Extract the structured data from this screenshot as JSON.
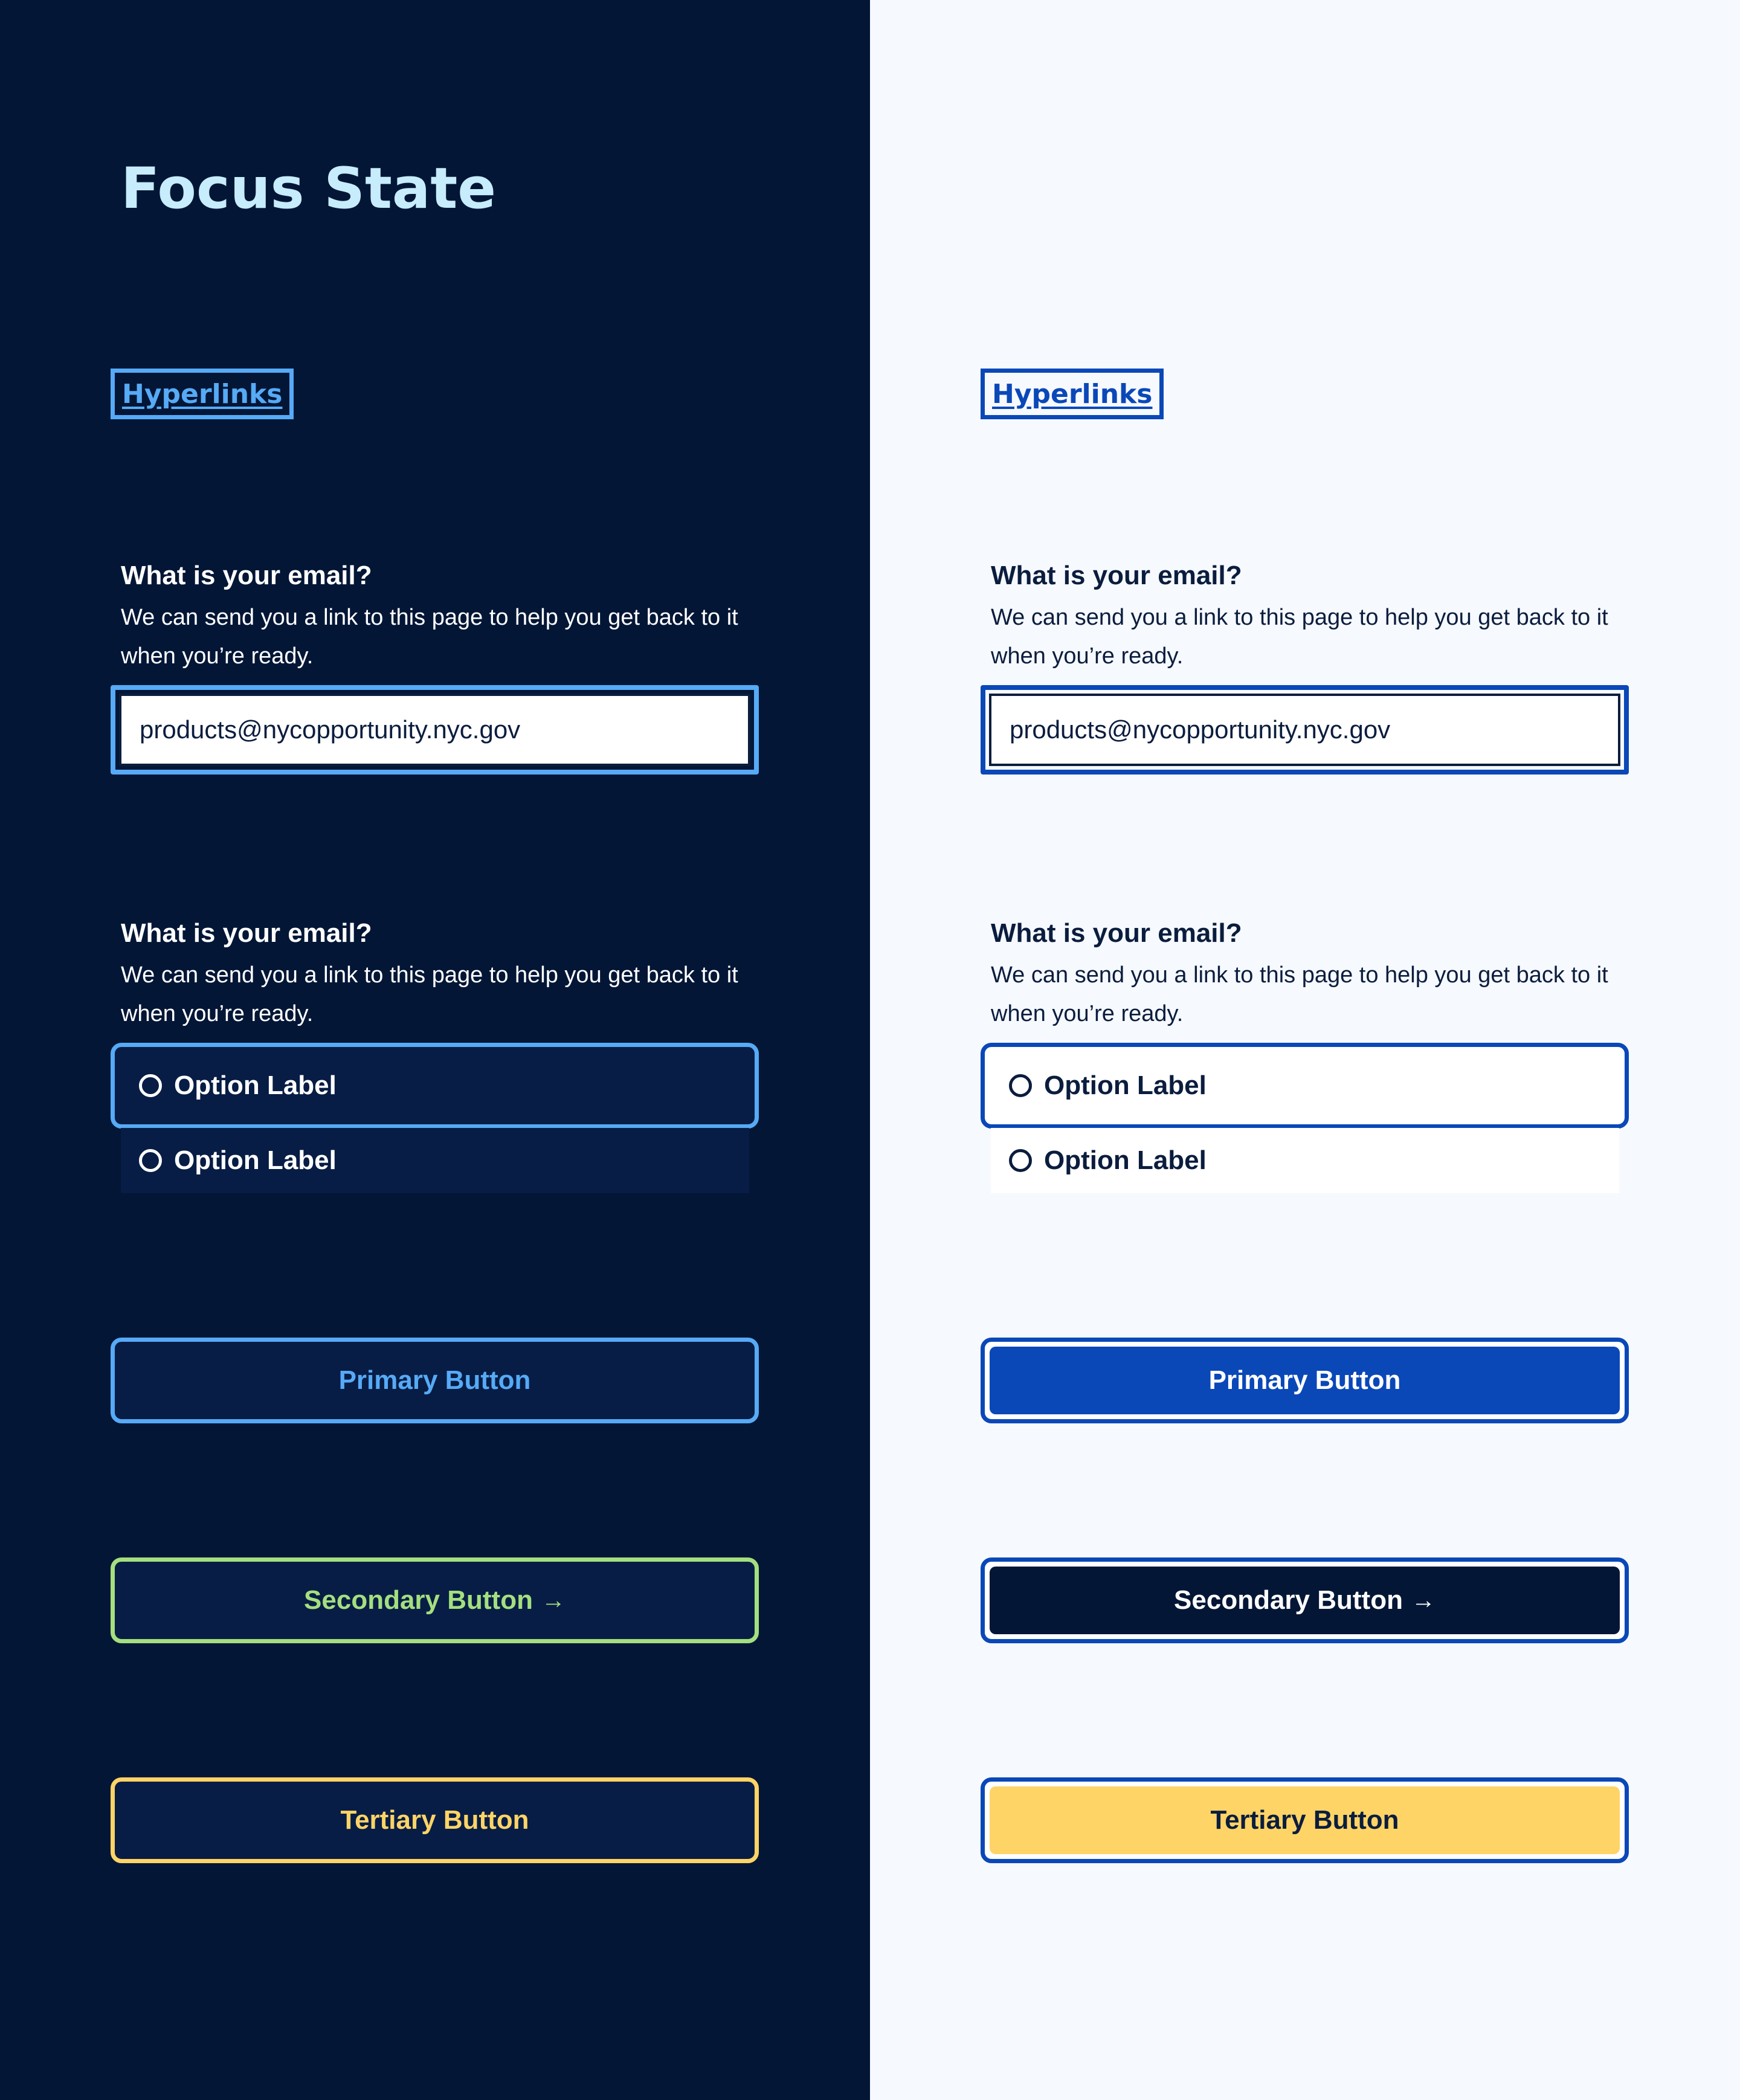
{
  "page": {
    "title": "Focus State"
  },
  "colors": {
    "dark_bg": "#031636",
    "light_bg": "#f6f9fe",
    "focus_blue_dark": "#56aaf6",
    "focus_blue_light": "#0a48b8",
    "secondary_green": "#a4df7f",
    "tertiary_yellow": "#ffd466",
    "navy": "#031636"
  },
  "dark": {
    "hyperlink": "Hyperlinks",
    "email_question": {
      "label": "What is your email?",
      "description": "We can send you a link to this page to help you get back to it when you’re ready.",
      "input_value": "products@nycopportunity.nyc.gov"
    },
    "radio_question": {
      "label": "What is your email?",
      "description": "We can send you a link to this page to help you get back to it when you’re ready.",
      "options": [
        "Option Label",
        "Option Label"
      ]
    },
    "buttons": {
      "primary": "Primary Button",
      "secondary": "Secondary Button",
      "secondary_icon": "arrow-right-icon",
      "tertiary": "Tertiary Button"
    }
  },
  "light": {
    "hyperlink": "Hyperlinks",
    "email_question": {
      "label": "What is your email?",
      "description": "We can send you a link to this page to help you get back to it when you’re ready.",
      "input_value": "products@nycopportunity.nyc.gov"
    },
    "radio_question": {
      "label": "What is your email?",
      "description": "We can send you a link to this page to help you get back to it when you’re ready.",
      "options": [
        "Option Label",
        "Option Label"
      ]
    },
    "buttons": {
      "primary": "Primary Button",
      "secondary": "Secondary Button",
      "secondary_icon": "arrow-right-icon",
      "tertiary": "Tertiary Button"
    }
  }
}
